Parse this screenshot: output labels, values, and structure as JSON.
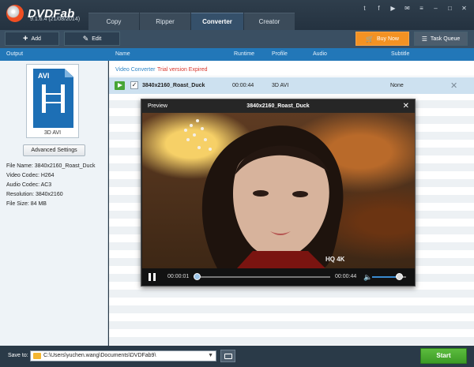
{
  "app": {
    "name": "DVDFab",
    "version": "9.1.6.4 (21/08/2014)"
  },
  "tabs": [
    {
      "label": "Copy"
    },
    {
      "label": "Ripper"
    },
    {
      "label": "Converter",
      "active": true
    },
    {
      "label": "Creator"
    }
  ],
  "topbar_icons": [
    "twitter-icon",
    "facebook-icon",
    "youtube-icon",
    "email-icon",
    "menu-icon",
    "minimize-icon",
    "maximize-icon",
    "close-icon"
  ],
  "toolbar": {
    "add_label": "Add",
    "edit_label": "Edit",
    "buy_label": "Buy Now",
    "queue_label": "Task Queue"
  },
  "columns": {
    "output": "Output",
    "name": "Name",
    "runtime": "Runtime",
    "profile": "Profile",
    "audio": "Audio",
    "subtitle": "Subtitle"
  },
  "left": {
    "format_badge": "AVI",
    "format_caption": "3D AVI",
    "advanced_settings": "Advanced Settings",
    "info": {
      "file_name": "File Name: 3840x2160_Roast_Duck",
      "video_codec": "Video Codec: H264",
      "audio_codec": "Audio Codec: AC3",
      "resolution": "Resolution: 3840x2160",
      "file_size": "File Size: 84 MB"
    }
  },
  "list": {
    "group_name": "Video Converter",
    "group_status": "Trial version  Expired",
    "file": {
      "name": "3840x2160_Roast_Duck",
      "runtime": "00:00:44",
      "profile": "3D AVI",
      "audio": "",
      "subtitle": "None",
      "checked": true
    }
  },
  "preview": {
    "title_label": "Preview",
    "file_title": "3840x2160_Roast_Duck",
    "time_current": "00:00:01",
    "time_total": "00:00:44",
    "progress": 0.02,
    "volume": 0.8
  },
  "bottom": {
    "save_to_label": "Save to:",
    "save_path": "C:\\Users\\yuchen.wang\\Documents\\DVDFab9\\",
    "start_label": "Start"
  }
}
